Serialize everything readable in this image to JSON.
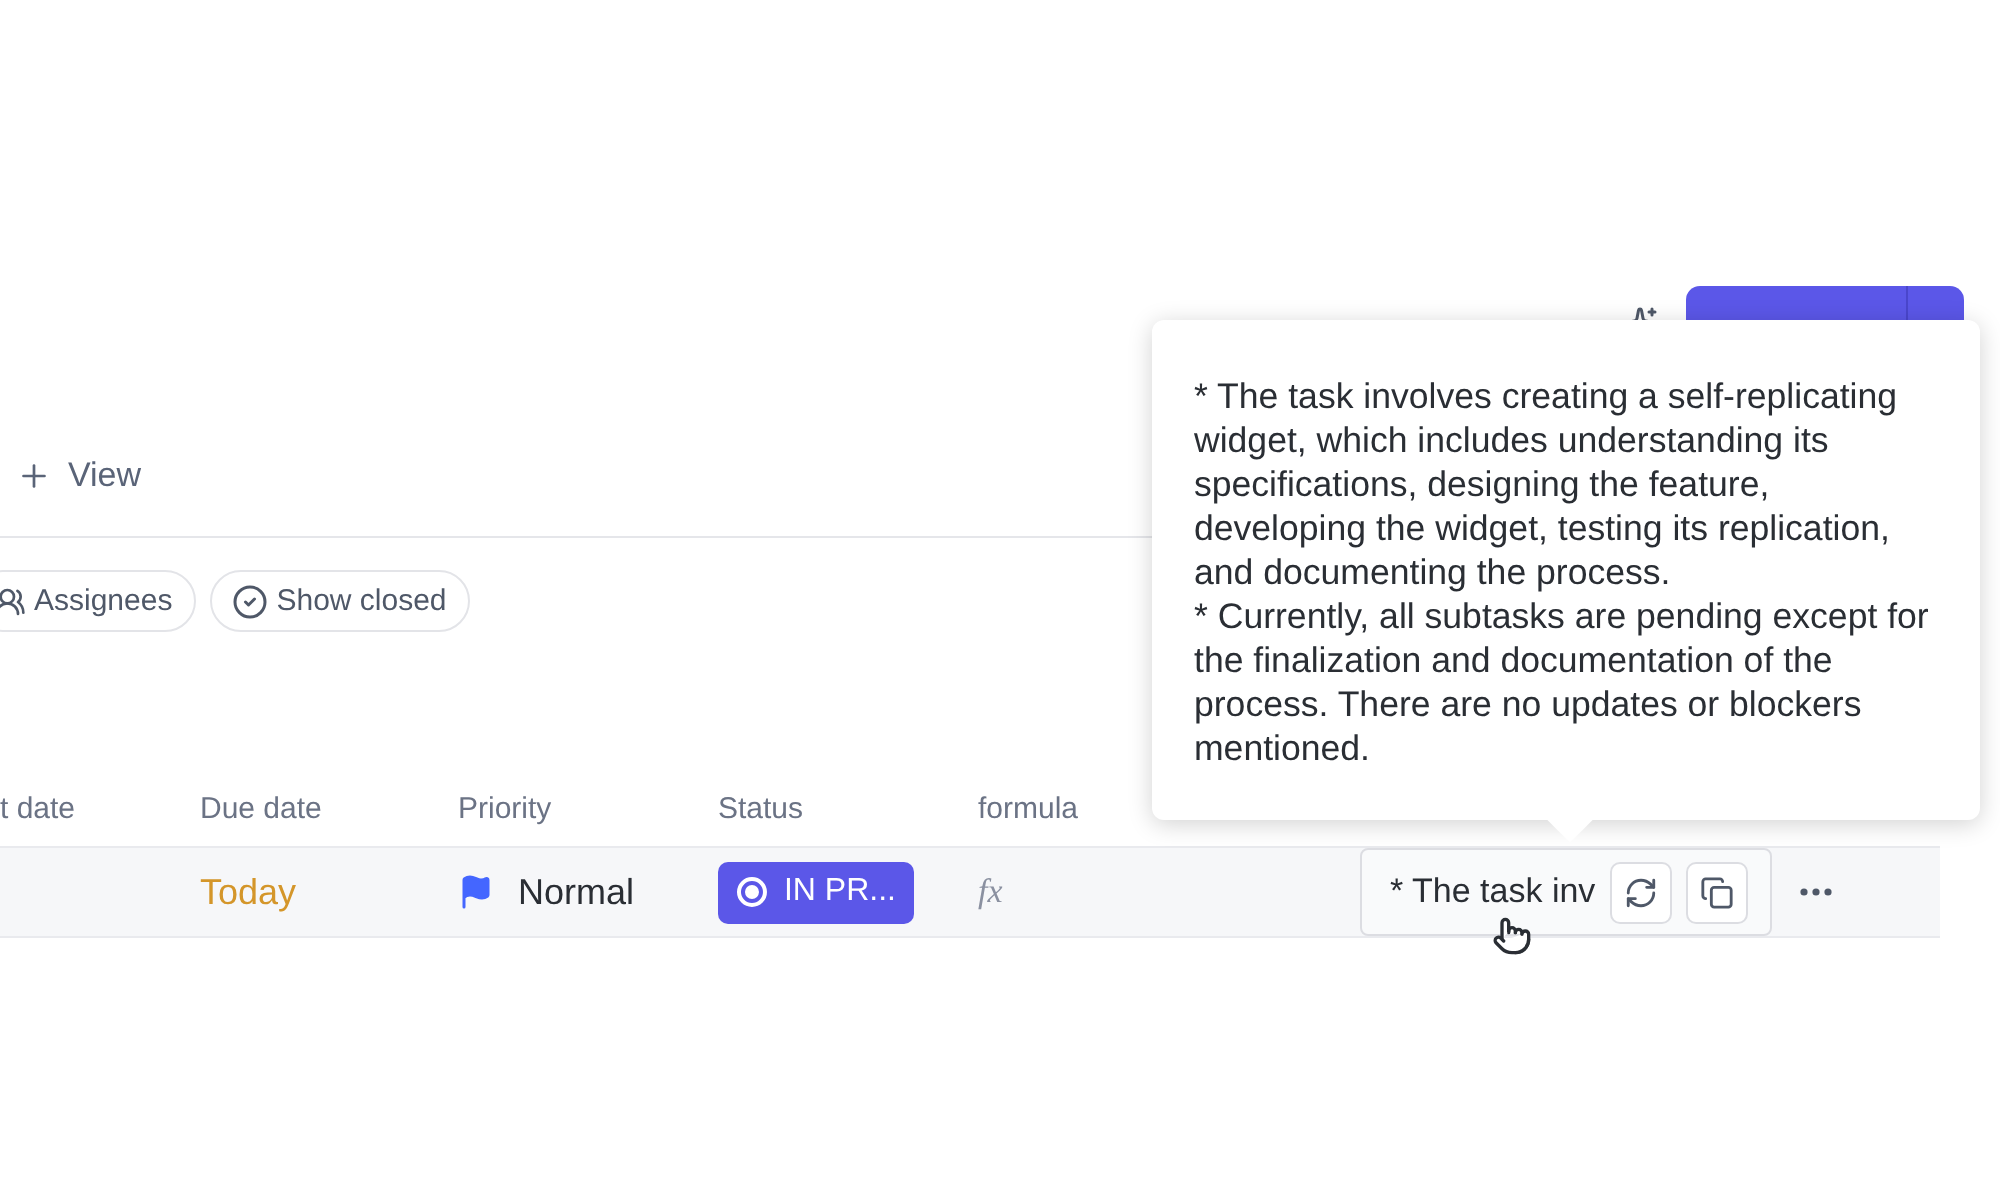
{
  "view_tab": {
    "label": "View"
  },
  "filters": [
    {
      "label": "Assignees",
      "kind": "person"
    },
    {
      "label": "Show closed",
      "kind": "check"
    }
  ],
  "table": {
    "columns": [
      "t date",
      "Due date",
      "Priority",
      "Status",
      "formula"
    ],
    "rows": [
      {
        "due_date": "Today",
        "priority": "Normal",
        "status": "IN PR...",
        "formula": "fx",
        "summary": "* The task inv"
      }
    ]
  },
  "tooltip": {
    "paragraphs": [
      "* The task involves creating a self-replicating widget, which includes understanding its specifications, designing the feature, developing the widget, testing its replication, and documenting the process.",
      "* Currently, all subtasks are pending except for the finalization and documentation of the process. There are no updates or blockers mentioned."
    ]
  }
}
